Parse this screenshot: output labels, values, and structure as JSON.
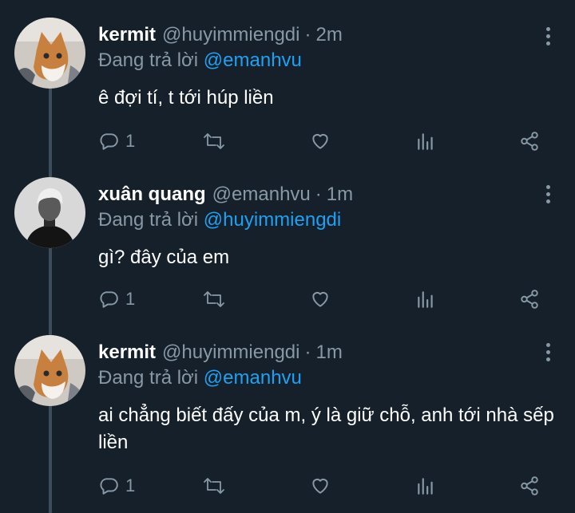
{
  "replying_prefix": "Đang trả lời",
  "tweets": [
    {
      "display_name": "kermit",
      "handle": "@huyimmiengdi",
      "separator": "·",
      "time": "2m",
      "reply_to": "@emanhvu",
      "text": "ê đợi tí, t tới húp liền",
      "reply_count": "1",
      "avatar": "cat-avatar"
    },
    {
      "display_name": "xuân quang",
      "handle": "@emanhvu",
      "separator": "·",
      "time": "1m",
      "reply_to": "@huyimmiengdi",
      "text": "gì? đây của em",
      "reply_count": "1",
      "avatar": "person-avatar"
    },
    {
      "display_name": "kermit",
      "handle": "@huyimmiengdi",
      "separator": "·",
      "time": "1m",
      "reply_to": "@emanhvu",
      "text": "ai chẳng biết đấy của m, ý là giữ chỗ, anh tới nhà sếp liền",
      "reply_count": "1",
      "avatar": "cat-avatar"
    }
  ],
  "colors": {
    "background": "#15202b",
    "secondary_text": "#8899a6",
    "mention": "#1da1f2",
    "thread_line": "#3d4c5b"
  },
  "icons": [
    "reply-icon",
    "retweet-icon",
    "like-icon",
    "analytics-icon",
    "share-icon",
    "more-options-icon"
  ]
}
